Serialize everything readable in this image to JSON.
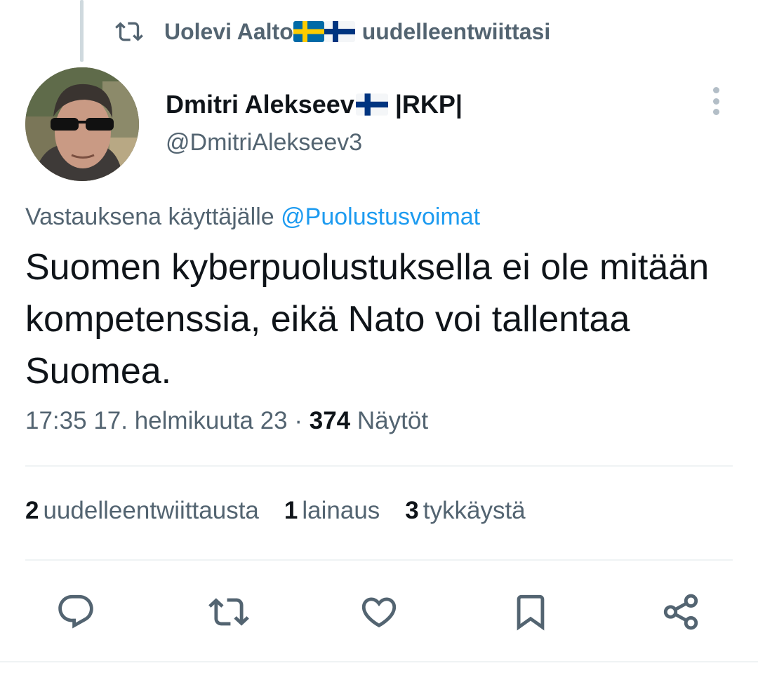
{
  "context": {
    "icon": "retweet-icon",
    "retweeter": "Uolevi Aalto",
    "retweeter_flags": [
      "sweden-flag",
      "finland-flag"
    ],
    "action_text": "uudelleentwiittasi"
  },
  "author": {
    "name": "Dmitri Alekseev",
    "name_flag": "finland-flag",
    "affiliation": "|RKP|",
    "handle": "@DmitriAlekseev3",
    "avatar": "profile-photo"
  },
  "more_icon": "more-vertical-icon",
  "reply": {
    "prefix": "Vastauksena käyttäjälle",
    "mention": "@Puolustusvoimat"
  },
  "tweet": {
    "text": "Suomen kyberpuolustuksella ei ole mitään kompetenssia, eikä Nato voi tallentaa Suomea."
  },
  "meta": {
    "time": "17:35",
    "date": "17. helmikuuta 23",
    "separator": "·",
    "views_count": "374",
    "views_label": "Näytöt"
  },
  "stats": [
    {
      "count": "2",
      "label": "uudelleentwiittausta"
    },
    {
      "count": "1",
      "label": "lainaus"
    },
    {
      "count": "3",
      "label": "tykkäystä"
    }
  ],
  "actions": [
    "reply-icon",
    "retweet-icon",
    "like-icon",
    "bookmark-icon",
    "share-icon"
  ],
  "colors": {
    "text_primary": "#0f1419",
    "text_secondary": "#536471",
    "link": "#1d9bf0",
    "divider": "#eff3f4"
  }
}
